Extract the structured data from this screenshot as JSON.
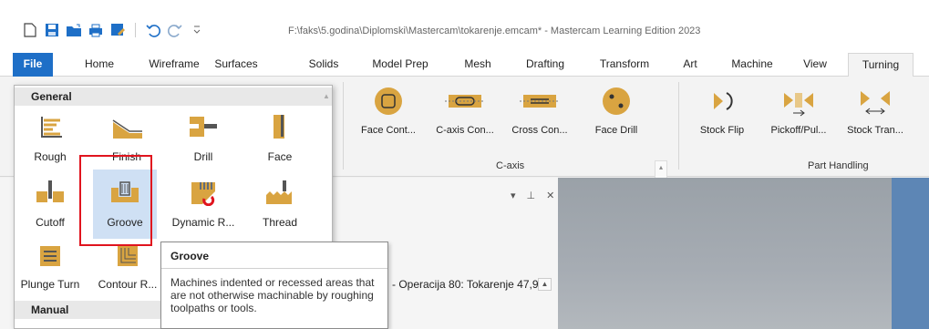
{
  "window": {
    "title": "F:\\faks\\5.godina\\Diplomski\\Mastercam\\tokarenje.emcam* - Mastercam Learning Edition 2023"
  },
  "quick_access": {
    "icons": [
      "new-file-icon",
      "save-icon",
      "open-icon",
      "print-icon",
      "save-as-icon",
      "undo-icon",
      "redo-icon",
      "customize-dropdown-icon"
    ]
  },
  "tabs": [
    "File",
    "Home",
    "Wireframe",
    "Surfaces",
    "Solids",
    "Model Prep",
    "Mesh",
    "Drafting",
    "Transform",
    "Art",
    "Machine",
    "View",
    "Turning"
  ],
  "active_tab": "Turning",
  "ribbon": {
    "caxis_buttons": [
      "Face Cont...",
      "C-axis Con...",
      "Cross Con...",
      "Face Drill"
    ],
    "caxis_group": "C-axis",
    "part_handling_buttons": [
      "Stock Flip",
      "Pickoff/Pul...",
      "Stock Tran..."
    ],
    "part_handling_group": "Part Handling"
  },
  "dropdown": {
    "general_header": "General",
    "general_items_row1": [
      "Rough",
      "Finish",
      "Drill",
      "Face"
    ],
    "general_items_row2": [
      "Cutoff",
      "Groove",
      "Dynamic R...",
      "Thread"
    ],
    "general_items_row3": [
      "Plunge Turn",
      "Contour R..."
    ],
    "manual_header": "Manual",
    "selected": "Groove"
  },
  "tooltip": {
    "title": "Groove",
    "description": "Machines indented or recessed areas that are not otherwise machinable by roughing toolpaths or tools."
  },
  "operations_panel": {
    "tree_item": "- Operacija 80: Tokarenje 47,9",
    "controls": [
      "▾",
      "⊥",
      "✕"
    ]
  },
  "colors": {
    "file_tab": "#1e6fc7",
    "selection": "#cfe0f4",
    "highlight": "#e0141e",
    "tool_gold": "#d9a441"
  }
}
